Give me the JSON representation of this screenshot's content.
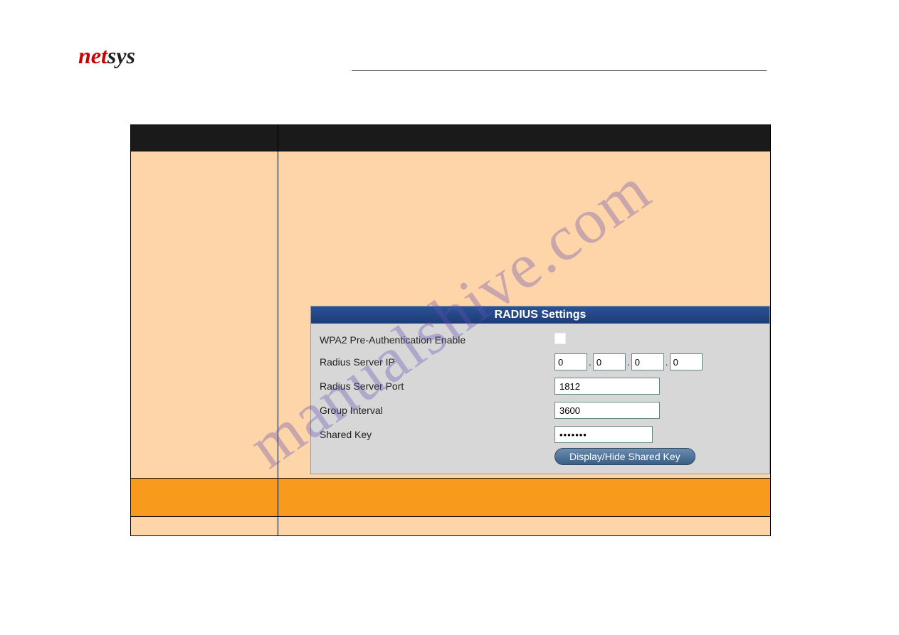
{
  "watermark": "manualshive.com",
  "logo": {
    "part1": "net",
    "part2": "sys"
  },
  "radius": {
    "title": "RADIUS Settings",
    "rows": {
      "preauth": {
        "label": "WPA2 Pre-Authentication Enable"
      },
      "serverip": {
        "label": "Radius Server IP",
        "oct1": "0",
        "oct2": "0",
        "oct3": "0",
        "oct4": "0"
      },
      "port": {
        "label": "Radius Server Port",
        "value": "1812"
      },
      "group": {
        "label": "Group Interval",
        "value": "3600"
      },
      "shared": {
        "label": "Shared Key",
        "value": "•••••••"
      }
    },
    "button": "Display/Hide Shared Key"
  }
}
